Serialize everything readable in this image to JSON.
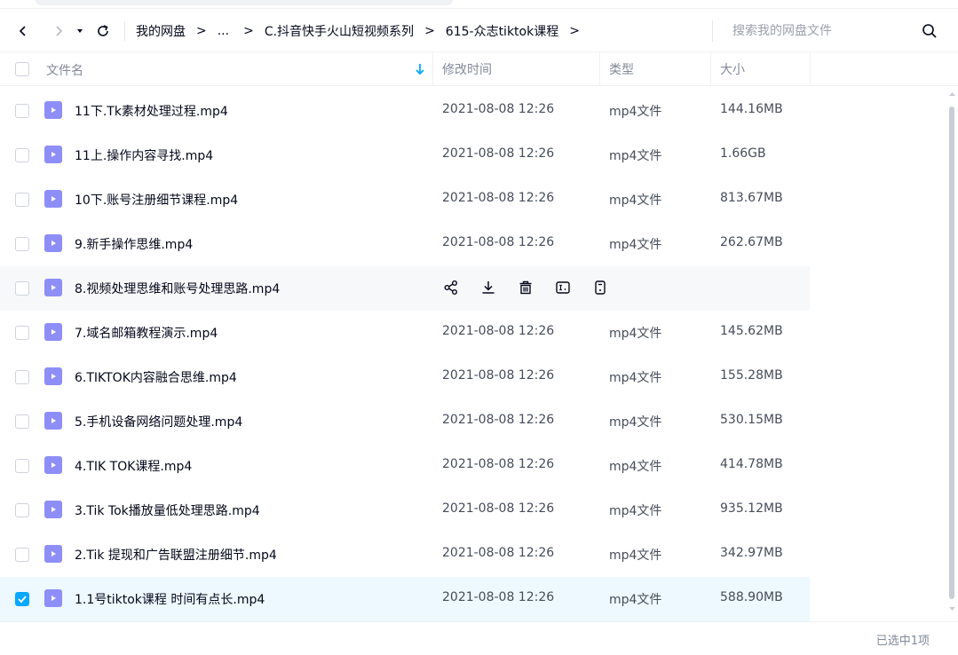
{
  "nav": {
    "breadcrumbs": [
      "我的网盘",
      "...",
      "C.抖音快手火山短视频系列",
      "615-众志tiktok课程"
    ],
    "separator": ">",
    "search_placeholder": "搜索我的网盘文件"
  },
  "columns": {
    "name": "文件名",
    "time": "修改时间",
    "type": "类型",
    "size": "大小"
  },
  "files": [
    {
      "name": "11下.Tk素材处理过程.mp4",
      "time": "2021-08-08 12:26",
      "type": "mp4文件",
      "size": "144.16MB"
    },
    {
      "name": "11上.操作内容寻找.mp4",
      "time": "2021-08-08 12:26",
      "type": "mp4文件",
      "size": "1.66GB"
    },
    {
      "name": "10下.账号注册细节课程.mp4",
      "time": "2021-08-08 12:26",
      "type": "mp4文件",
      "size": "813.67MB"
    },
    {
      "name": "9.新手操作思维.mp4",
      "time": "2021-08-08 12:26",
      "type": "mp4文件",
      "size": "262.67MB"
    },
    {
      "name": "8.视频处理思维和账号处理思路.mp4",
      "time": "",
      "type": "",
      "size": ""
    },
    {
      "name": "7.域名邮箱教程演示.mp4",
      "time": "2021-08-08 12:26",
      "type": "mp4文件",
      "size": "145.62MB"
    },
    {
      "name": "6.TIKTOK内容融合思维.mp4",
      "time": "2021-08-08 12:26",
      "type": "mp4文件",
      "size": "155.28MB"
    },
    {
      "name": "5.手机设备网络问题处理.mp4",
      "time": "2021-08-08 12:26",
      "type": "mp4文件",
      "size": "530.15MB"
    },
    {
      "name": "4.TIK TOK课程.mp4",
      "time": "2021-08-08 12:26",
      "type": "mp4文件",
      "size": "414.78MB"
    },
    {
      "name": "3.Tik Tok播放量低处理思路.mp4",
      "time": "2021-08-08 12:26",
      "type": "mp4文件",
      "size": "935.12MB"
    },
    {
      "name": "2.Tik 提现和广告联盟注册细节.mp4",
      "time": "2021-08-08 12:26",
      "type": "mp4文件",
      "size": "342.97MB"
    },
    {
      "name": "1.1号tiktok课程 时间有点长.mp4",
      "time": "2021-08-08 12:26",
      "type": "mp4文件",
      "size": "588.90MB"
    }
  ],
  "hover_row": 4,
  "selected_row": 11,
  "row_action_icons": [
    "share-icon",
    "download-icon",
    "delete-icon",
    "rename-icon",
    "more-icon"
  ],
  "status": "已选中1项",
  "colors": {
    "accent": "#06a7ff",
    "video_icon": "#8e8ef8",
    "hover_bg": "#f7f8fa",
    "selected_bg": "#eef8ff"
  }
}
